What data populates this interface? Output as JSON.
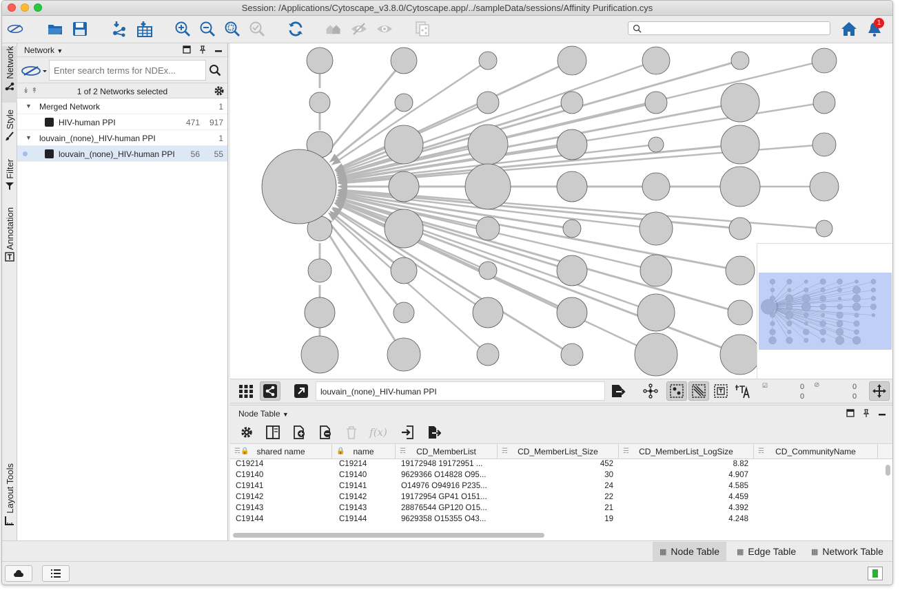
{
  "window": {
    "title": "Session: /Applications/Cytoscape_v3.8.0/Cytoscape.app/../sampleData/sessions/Affinity Purification.cys"
  },
  "toolbar": {
    "search_placeholder": "",
    "notification_count": "1",
    "icons": [
      "cytoscape-logo-icon",
      "open-folder-icon",
      "save-icon",
      "import-network-icon",
      "import-table-icon",
      "zoom-in-icon",
      "zoom-out-icon",
      "zoom-fit-icon",
      "zoom-selected-icon",
      "refresh-icon",
      "home-network-icon",
      "hide-icon",
      "show-icon",
      "copy-network-icon",
      "home-icon",
      "bell-icon"
    ]
  },
  "side_tabs": [
    {
      "label": "Network",
      "icon": "network-icon",
      "selected": true
    },
    {
      "label": "Style",
      "icon": "brush-icon",
      "selected": false
    },
    {
      "label": "Filter",
      "icon": "filter-icon",
      "selected": false
    },
    {
      "label": "Annotation",
      "icon": "annotation-icon",
      "selected": false
    },
    {
      "label": "Layout Tools",
      "icon": "ruler-icon",
      "selected": false
    }
  ],
  "network_panel": {
    "header": "Network",
    "ndex_placeholder": "Enter search terms for NDEx...",
    "selection_status": "1 of 2 Networks selected",
    "collections": [
      {
        "name": "Merged Network",
        "count": "1",
        "networks": [
          {
            "name": "HIV-human PPI",
            "nodes": "471",
            "edges": "917",
            "selected": false
          }
        ]
      },
      {
        "name": "louvain_(none)_HIV-human PPI",
        "count": "1",
        "networks": [
          {
            "name": "louvain_(none)_HIV-human PPI",
            "nodes": "56",
            "edges": "55",
            "selected": true
          }
        ]
      }
    ]
  },
  "network_view": {
    "title": "louvain_(none)_HIV-human PPI",
    "stats": {
      "sel_nodes": "0",
      "sel_edges": "0",
      "hidden_nodes": "0",
      "hidden_edges": "0"
    },
    "node_color": "#cccccc",
    "edge_color": "#bbbbbb"
  },
  "table_panel": {
    "header": "Node Table",
    "columns": [
      "shared name",
      "name",
      "CD_MemberList",
      "CD_MemberList_Size",
      "CD_MemberList_LogSize",
      "CD_CommunityName"
    ],
    "rows": [
      [
        "C19214",
        "C19214",
        "19172948 19172951 ...",
        "452",
        "8.82",
        ""
      ],
      [
        "C19140",
        "C19140",
        "9629366 O14828 O95...",
        "30",
        "4.907",
        ""
      ],
      [
        "C19141",
        "C19141",
        "O14976 O94916 P235...",
        "24",
        "4.585",
        ""
      ],
      [
        "C19142",
        "C19142",
        "19172954 GP41 O151...",
        "22",
        "4.459",
        ""
      ],
      [
        "C19143",
        "C19143",
        "28876544 GP120 O15...",
        "21",
        "4.392",
        ""
      ],
      [
        "C19144",
        "C19144",
        "9629358 O15355 O43...",
        "19",
        "4.248",
        ""
      ]
    ]
  },
  "bottom_tabs": [
    "Node Table",
    "Edge Table",
    "Network Table"
  ],
  "colors": {
    "accent": "#2a6ab5",
    "badge": "#e51d1d",
    "selection": "#dde8f7"
  }
}
